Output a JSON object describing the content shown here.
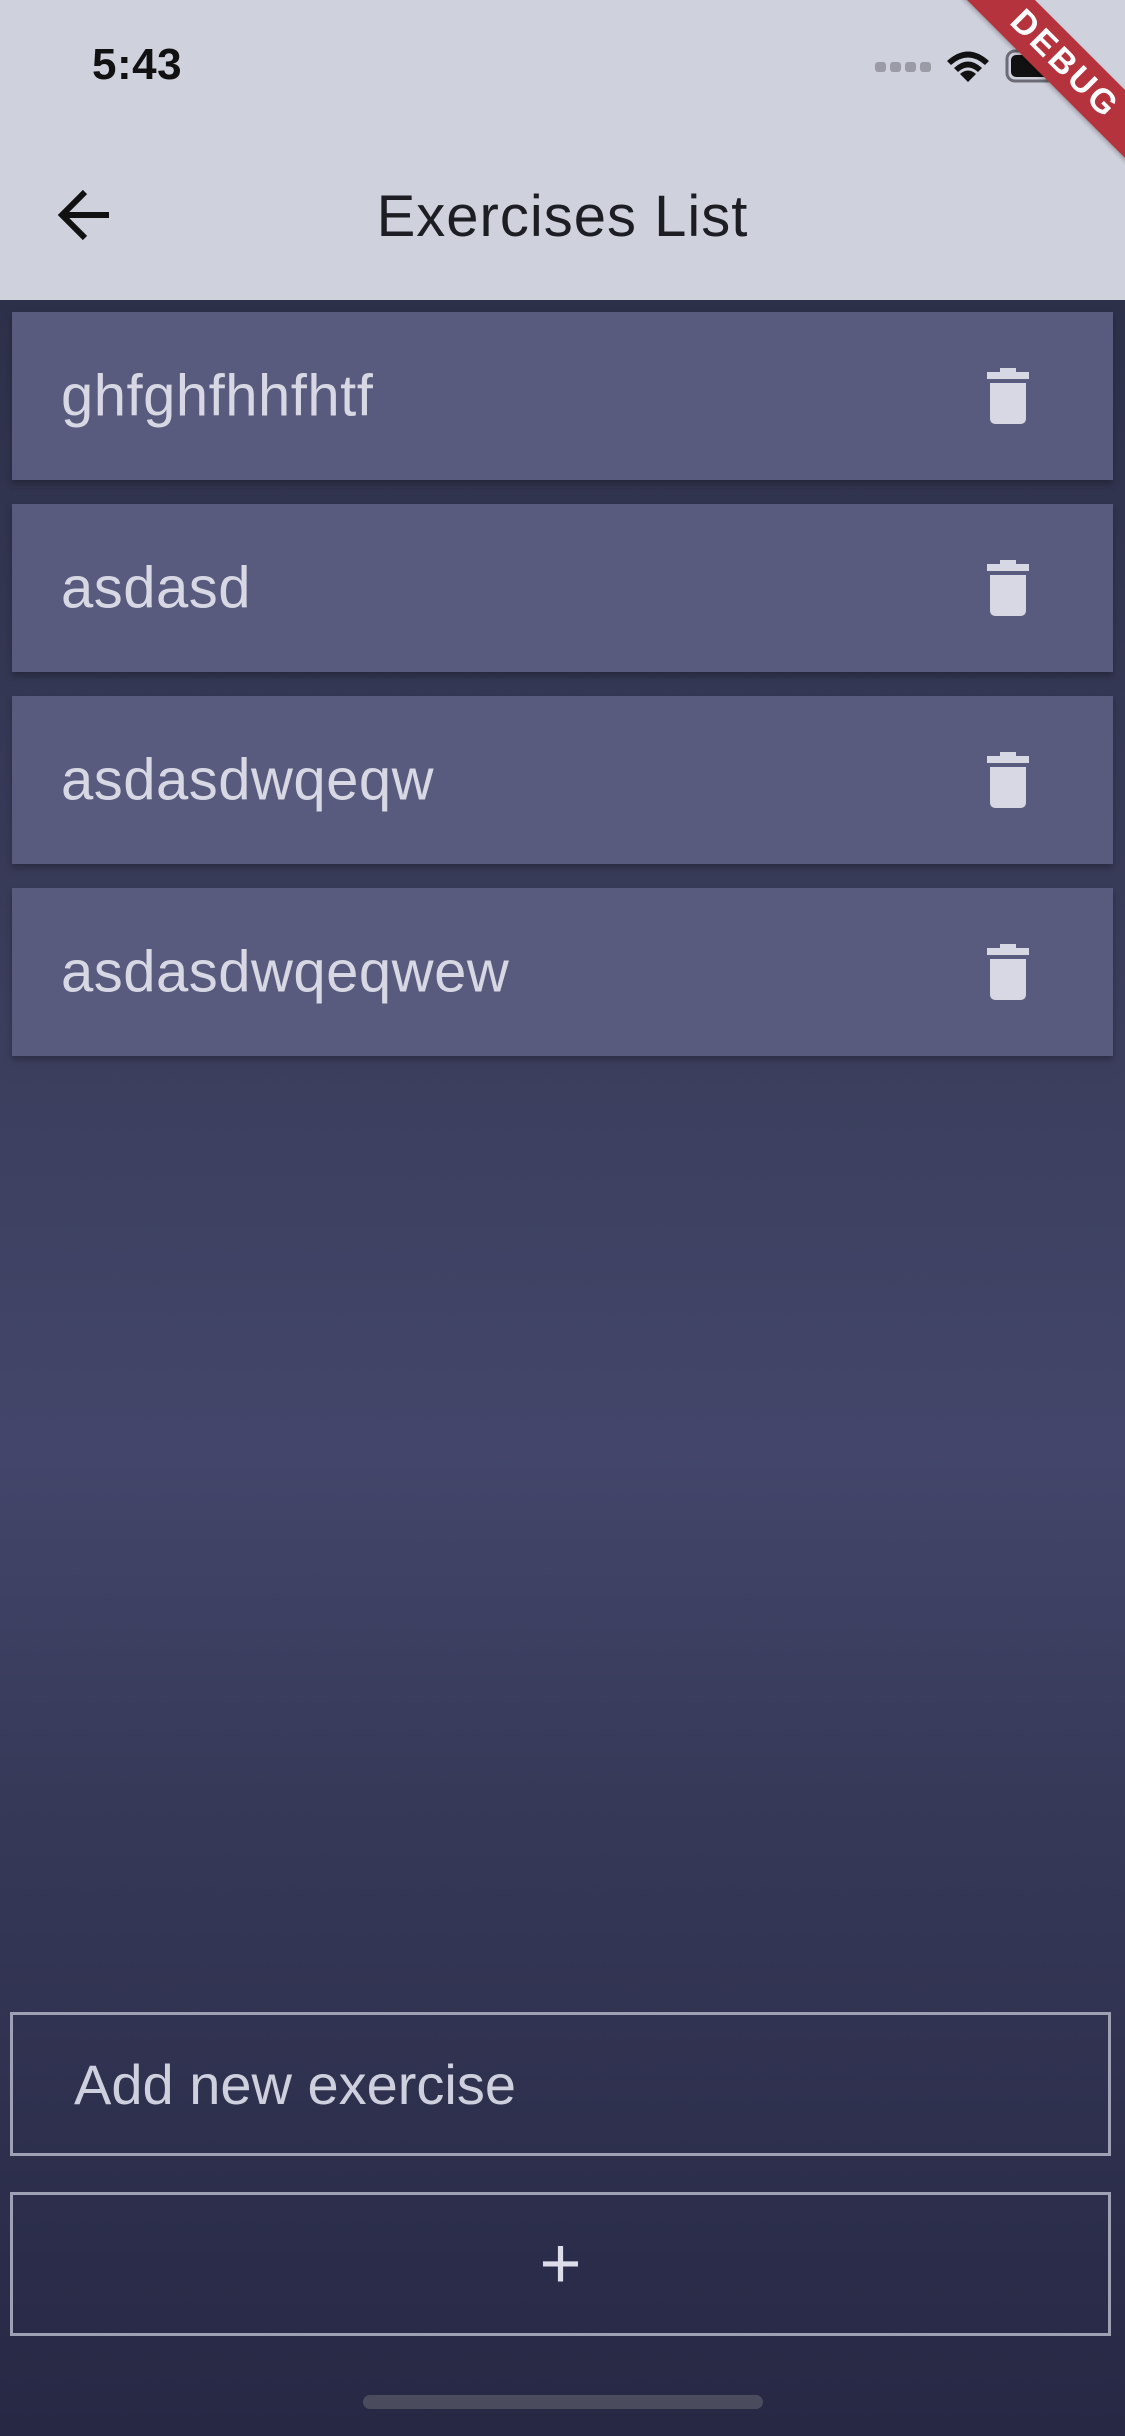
{
  "status_bar": {
    "time": "5:43",
    "icons": [
      "signal-icon",
      "wifi-icon",
      "battery-icon"
    ]
  },
  "debug_banner": "DEBUG",
  "app_bar": {
    "title": "Exercises List",
    "back_icon": "arrow-back-icon"
  },
  "exercises": [
    {
      "name": "ghfghfhhfhtf",
      "action_icon": "trash-icon"
    },
    {
      "name": "asdasd",
      "action_icon": "trash-icon"
    },
    {
      "name": "asdasdwqeqw",
      "action_icon": "trash-icon"
    },
    {
      "name": "asdasdwqeqwew",
      "action_icon": "trash-icon"
    }
  ],
  "add_exercise": {
    "placeholder": "Add new exercise",
    "value": "",
    "button_label": "+"
  },
  "colors": {
    "app_bar": "#cfd1dc",
    "list_item": "#585b7e",
    "background_dark": "#262844",
    "debug_ribbon": "#b5333c",
    "text_light": "#d7d8e4"
  }
}
